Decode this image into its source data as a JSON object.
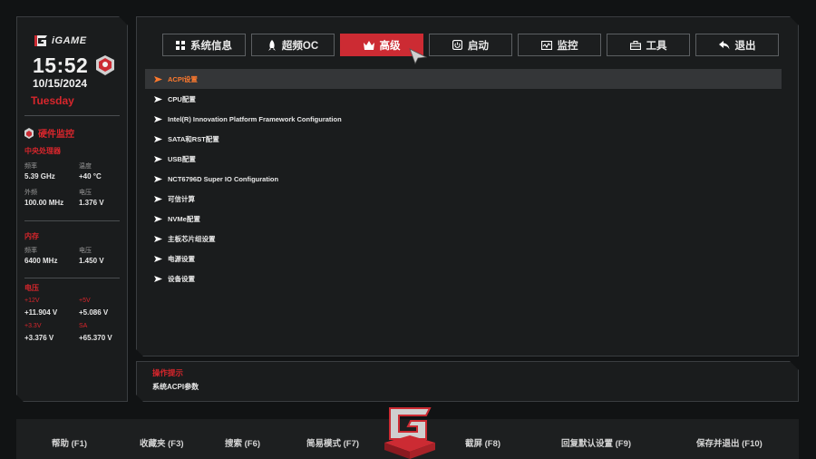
{
  "brand": {
    "logo_text": "iGAME"
  },
  "clock": {
    "time": "15:52",
    "date": "10/15/2024",
    "day": "Tuesday"
  },
  "hardware_monitor": {
    "title": "硬件监控",
    "cpu": {
      "title": "中央处理器",
      "freq_label": "频率",
      "freq": "5.39 GHz",
      "temp_label": "温度",
      "temp": "+40 °C",
      "ext_label": "外频",
      "ext": "100.00 MHz",
      "volt_label": "电压",
      "volt": "1.376 V"
    },
    "memory": {
      "title": "内存",
      "freq_label": "频率",
      "freq": "6400 MHz",
      "volt_label": "电压",
      "volt": "1.450 V"
    },
    "voltage": {
      "title": "电压",
      "v12_label": "+12V",
      "v12": "+11.904 V",
      "v5_label": "+5V",
      "v5": "+5.086 V",
      "v33_label": "+3.3V",
      "v33": "+3.376 V",
      "sa_label": "SA",
      "sa": "+65.370 V"
    }
  },
  "tabs": [
    {
      "label": "系统信息",
      "icon": "grid-icon"
    },
    {
      "label": "超频OC",
      "icon": "rocket-icon"
    },
    {
      "label": "高级",
      "icon": "crown-icon",
      "active": true
    },
    {
      "label": "启动",
      "icon": "power-icon"
    },
    {
      "label": "监控",
      "icon": "monitor-icon"
    },
    {
      "label": "工具",
      "icon": "toolbox-icon"
    },
    {
      "label": "退出",
      "icon": "back-arrow-icon"
    }
  ],
  "menu_items": [
    {
      "label": "ACPI设置",
      "selected": true
    },
    {
      "label": "CPU配置"
    },
    {
      "label": "Intel(R) Innovation Platform Framework Configuration"
    },
    {
      "label": "SATA和RST配置"
    },
    {
      "label": "USB配置"
    },
    {
      "label": "NCT6796D Super IO Configuration"
    },
    {
      "label": "可信计算"
    },
    {
      "label": "NVMe配置"
    },
    {
      "label": "主板芯片组设置"
    },
    {
      "label": "电源设置"
    },
    {
      "label": "设备设置"
    }
  ],
  "hint": {
    "title": "操作提示",
    "text": "系统ACPI参数"
  },
  "footer": {
    "help": "帮助 (F1)",
    "favorites": "收藏夹 (F3)",
    "search": "搜索 (F6)",
    "easy_mode": "简易模式 (F7)",
    "screenshot": "截屏 (F8)",
    "load_defaults": "回复默认设置 (F9)",
    "save_exit": "保存并退出 (F10)"
  },
  "colors": {
    "accent": "#cc2b33",
    "selected_text": "#ff7a2e",
    "panel": "#1a1c1d"
  }
}
